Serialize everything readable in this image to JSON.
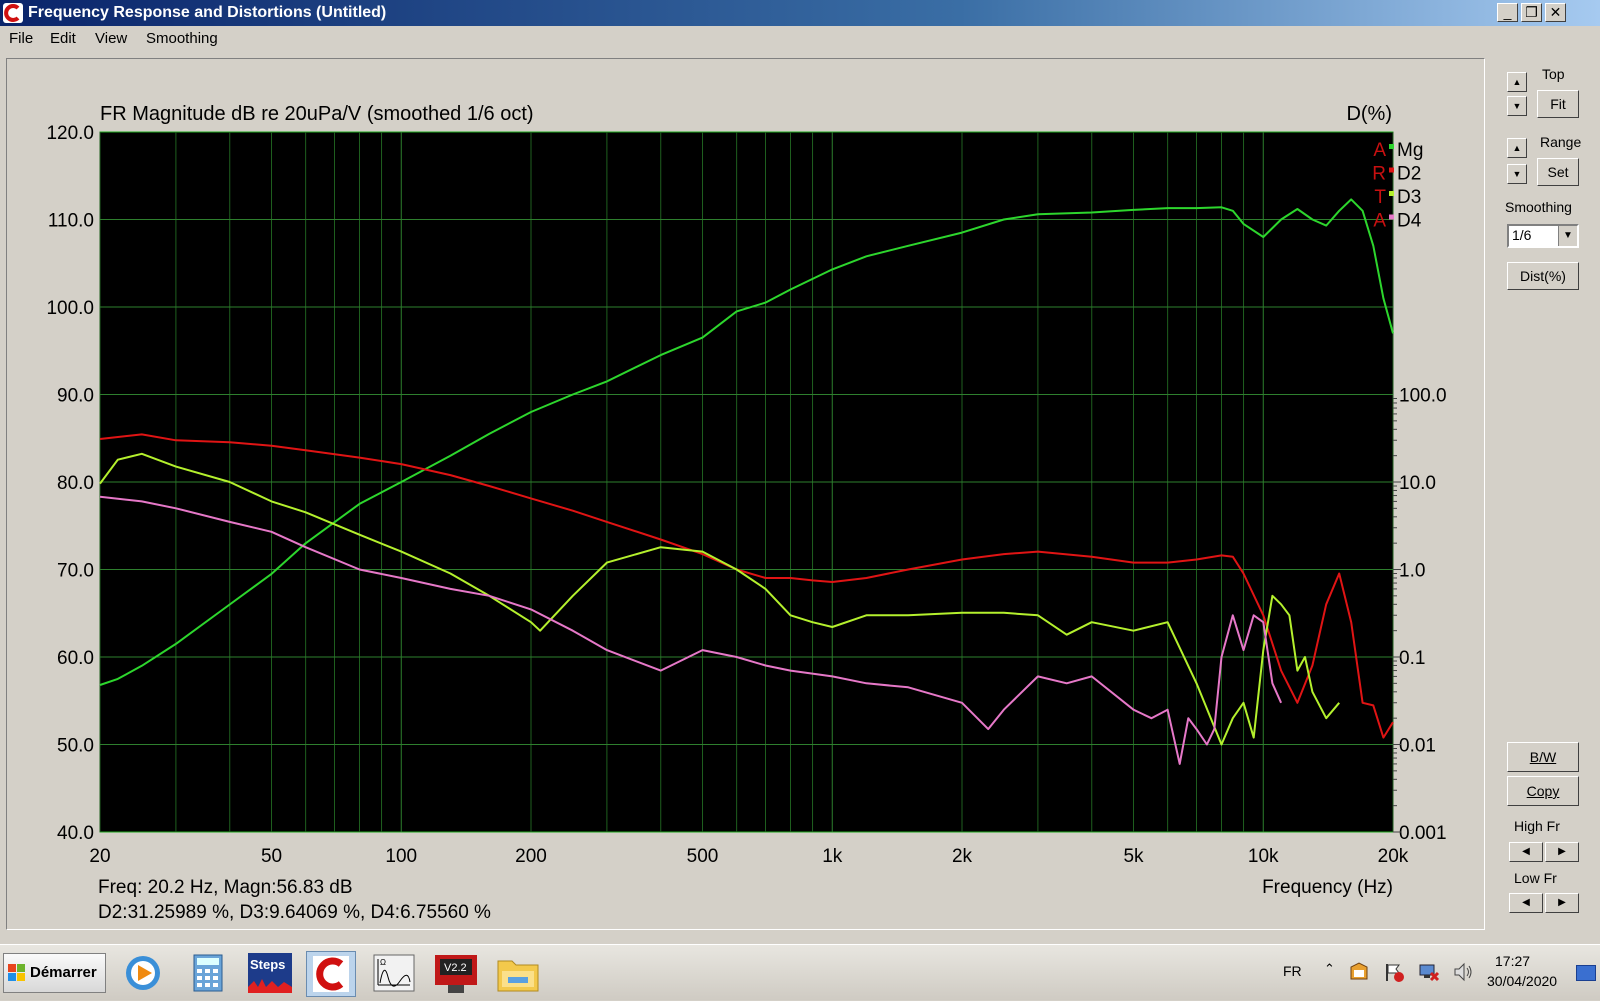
{
  "window": {
    "title": "Frequency Response and Distortions (Untitled)"
  },
  "menu": [
    "File",
    "Edit",
    "View",
    "Smoothing"
  ],
  "plot": {
    "title": "FR Magnitude dB re 20uPa/V (smoothed 1/6 oct)",
    "right_axis_title": "D(%)",
    "x_axis_label": "Frequency (Hz)",
    "readout_line1": "Freq: 20.2 Hz, Magn:56.83 dB",
    "readout_line2": "D2:31.25989 %, D3:9.64069 %, D4:6.75560 %",
    "legend": [
      {
        "letter": "A",
        "name": "Mg",
        "color": "#2dd62d"
      },
      {
        "letter": "R",
        "name": "D2",
        "color": "#e01414"
      },
      {
        "letter": "T",
        "name": "D3",
        "color": "#b4f02d"
      },
      {
        "letter": "A",
        "name": "D4",
        "color": "#e678c8"
      }
    ]
  },
  "sidebar": {
    "top_label": "Top",
    "fit_label": "Fit",
    "range_label": "Range",
    "set_label": "Set",
    "smoothing_label": "Smoothing",
    "smoothing_value": "1/6",
    "dist_label": "Dist(%)",
    "bw_label": "B/W",
    "copy_label": "Copy",
    "high_fr_label": "High Fr",
    "low_fr_label": "Low Fr"
  },
  "taskbar": {
    "start_label": "Démarrer",
    "apps": [
      "media-player",
      "calculator",
      "steps",
      "rew-active",
      "spectrum",
      "vz-app",
      "file-explorer"
    ],
    "steps_label": "Steps",
    "lang": "FR",
    "time": "17:27",
    "date": "30/04/2020"
  },
  "chart_data": {
    "type": "line",
    "title": "FR Magnitude dB re 20uPa/V (smoothed 1/6 oct)",
    "xlabel": "Frequency (Hz)",
    "ylabel": "",
    "y2label": "D(%)",
    "x_scale": "log",
    "xlim": [
      20,
      20000
    ],
    "ylim": [
      40,
      120
    ],
    "y2_scale": "log",
    "y2lim": [
      0.001,
      100
    ],
    "grid": true,
    "legend_position": "top-right",
    "x_ticks": [
      {
        "v": 20,
        "label": "20"
      },
      {
        "v": 50,
        "label": "50"
      },
      {
        "v": 100,
        "label": "100"
      },
      {
        "v": 200,
        "label": "200"
      },
      {
        "v": 500,
        "label": "500"
      },
      {
        "v": 1000,
        "label": "1k"
      },
      {
        "v": 2000,
        "label": "2k"
      },
      {
        "v": 5000,
        "label": "5k"
      },
      {
        "v": 10000,
        "label": "10k"
      },
      {
        "v": 20000,
        "label": "20k"
      }
    ],
    "y_ticks": [
      "40.0",
      "50.0",
      "60.0",
      "70.0",
      "80.0",
      "90.0",
      "100.0",
      "110.0",
      "120.0"
    ],
    "y2_ticks": [
      {
        "v": 0.001,
        "label": "0.001"
      },
      {
        "v": 0.01,
        "label": "0.01"
      },
      {
        "v": 0.1,
        "label": "0.1"
      },
      {
        "v": 1,
        "label": "1.0"
      },
      {
        "v": 10,
        "label": "10.0"
      },
      {
        "v": 100,
        "label": "100.0"
      }
    ],
    "series": [
      {
        "name": "Mg",
        "axis": "left",
        "color": "#2dd62d",
        "x": [
          20,
          22,
          25,
          30,
          40,
          50,
          60,
          80,
          100,
          130,
          160,
          200,
          250,
          300,
          400,
          500,
          600,
          700,
          800,
          1000,
          1200,
          1500,
          2000,
          2500,
          3000,
          4000,
          5000,
          6000,
          7000,
          8000,
          8500,
          9000,
          10000,
          11000,
          12000,
          13000,
          14000,
          15000,
          16000,
          17000,
          18000,
          19000,
          20000
        ],
        "y": [
          56.8,
          57.5,
          59,
          61.5,
          66,
          69.5,
          73,
          77.5,
          80,
          83,
          85.5,
          88,
          90,
          91.5,
          94.5,
          96.5,
          99.5,
          100.5,
          102,
          104.3,
          105.8,
          107,
          108.5,
          110,
          110.6,
          110.8,
          111.1,
          111.3,
          111.3,
          111.4,
          111,
          109.5,
          108,
          110,
          111.2,
          110,
          109.3,
          111,
          112.3,
          111,
          107,
          101,
          97
        ]
      },
      {
        "name": "D2",
        "axis": "right",
        "color": "#e01414",
        "x": [
          20,
          25,
          30,
          40,
          50,
          60,
          80,
          100,
          130,
          160,
          200,
          250,
          300,
          400,
          500,
          600,
          700,
          800,
          900,
          1000,
          1200,
          1500,
          2000,
          2500,
          3000,
          4000,
          5000,
          6000,
          7000,
          8000,
          8500,
          9000,
          10000,
          11000,
          12000,
          13000,
          14000,
          15000,
          16000,
          17000,
          18000,
          19000,
          20000
        ],
        "y": [
          31,
          35,
          30,
          28.5,
          26,
          23,
          19,
          16,
          12,
          9,
          6.5,
          4.7,
          3.5,
          2.2,
          1.5,
          1,
          0.8,
          0.8,
          0.75,
          0.72,
          0.8,
          1,
          1.3,
          1.5,
          1.6,
          1.4,
          1.2,
          1.2,
          1.3,
          1.45,
          1.4,
          0.9,
          0.3,
          0.07,
          0.03,
          0.08,
          0.4,
          0.9,
          0.25,
          0.03,
          0.028,
          0.012,
          0.018
        ]
      },
      {
        "name": "D3",
        "axis": "right",
        "color": "#b4f02d",
        "x": [
          20,
          22,
          25,
          30,
          40,
          50,
          60,
          80,
          100,
          130,
          160,
          200,
          210,
          250,
          300,
          400,
          500,
          600,
          700,
          800,
          900,
          1000,
          1200,
          1500,
          2000,
          2500,
          3000,
          3500,
          4000,
          5000,
          6000,
          7000,
          8000,
          8500,
          9000,
          9500,
          10000,
          10500,
          11000,
          11500,
          12000,
          12500,
          13000,
          14000,
          15000
        ],
        "y": [
          9.6,
          18,
          21,
          15,
          10,
          6,
          4.5,
          2.5,
          1.6,
          0.9,
          0.5,
          0.25,
          0.2,
          0.5,
          1.2,
          1.8,
          1.6,
          1,
          0.6,
          0.3,
          0.25,
          0.22,
          0.3,
          0.3,
          0.32,
          0.32,
          0.3,
          0.18,
          0.25,
          0.2,
          0.25,
          0.05,
          0.01,
          0.02,
          0.03,
          0.012,
          0.12,
          0.5,
          0.4,
          0.3,
          0.07,
          0.1,
          0.04,
          0.02,
          0.03
        ]
      },
      {
        "name": "D4",
        "axis": "right",
        "color": "#e678c8",
        "x": [
          20,
          25,
          30,
          40,
          50,
          60,
          80,
          100,
          130,
          160,
          200,
          250,
          300,
          400,
          500,
          600,
          700,
          800,
          1000,
          1200,
          1500,
          2000,
          2300,
          2500,
          3000,
          3500,
          4000,
          5000,
          5500,
          6000,
          6400,
          6700,
          7000,
          7400,
          7700,
          8000,
          8500,
          9000,
          9500,
          10000,
          10500,
          11000
        ],
        "y": [
          6.8,
          6,
          5,
          3.5,
          2.7,
          1.8,
          1,
          0.8,
          0.6,
          0.5,
          0.35,
          0.2,
          0.12,
          0.07,
          0.12,
          0.1,
          0.08,
          0.07,
          0.06,
          0.05,
          0.045,
          0.03,
          0.015,
          0.025,
          0.06,
          0.05,
          0.06,
          0.025,
          0.02,
          0.025,
          0.006,
          0.02,
          0.015,
          0.01,
          0.015,
          0.1,
          0.3,
          0.12,
          0.3,
          0.25,
          0.05,
          0.03
        ]
      }
    ]
  }
}
